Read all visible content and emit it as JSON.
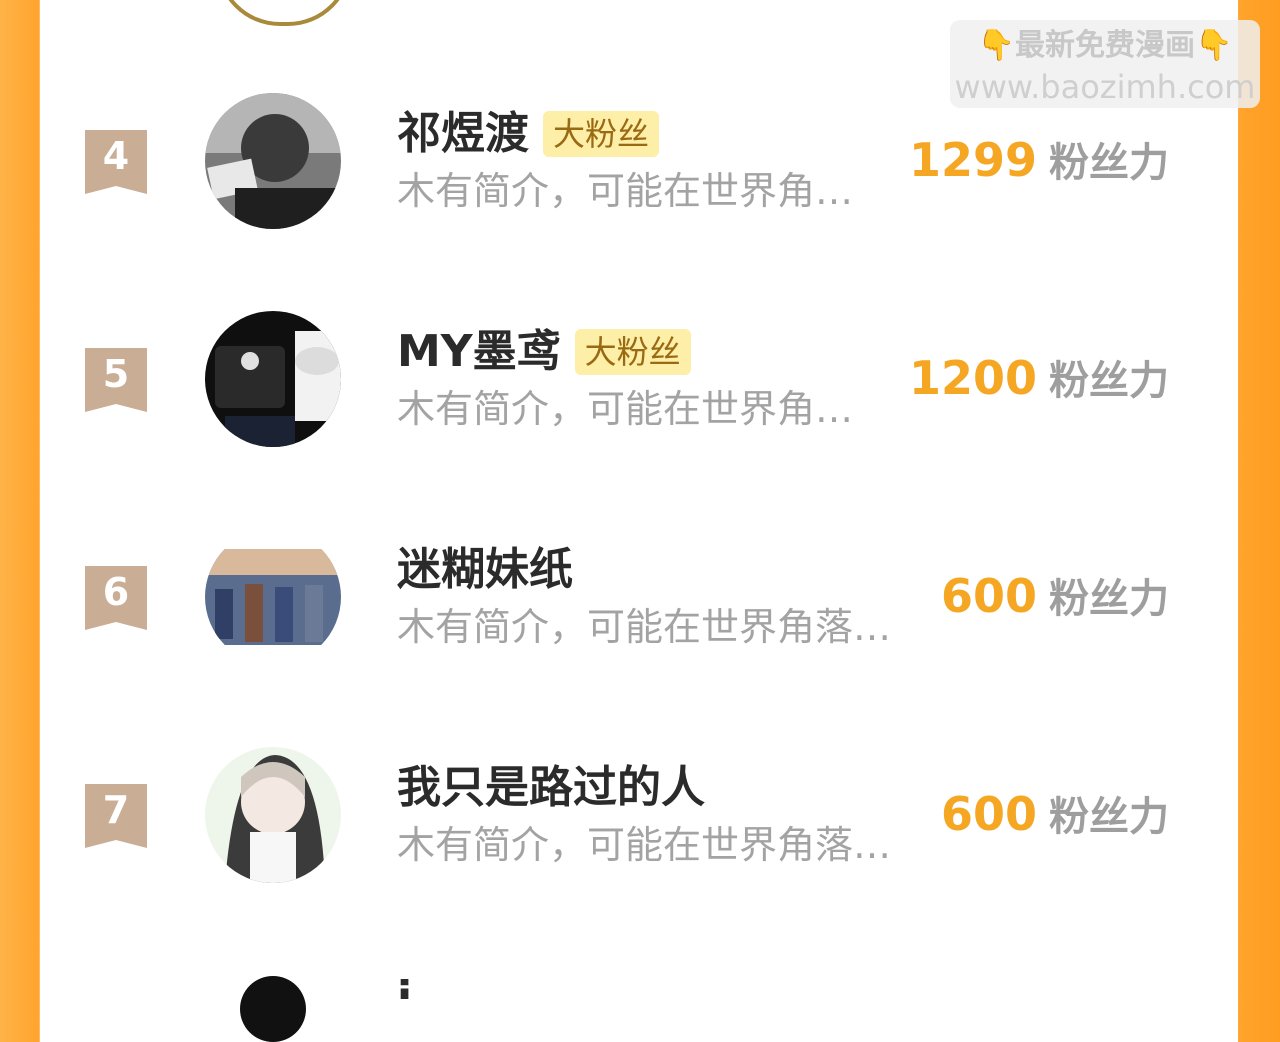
{
  "watermark": {
    "hand_left": "👇",
    "text": "最新免费漫画",
    "hand_right": "👇",
    "url": "www.baozimh.com"
  },
  "ranking": [
    {
      "rank": "4",
      "name": "祁煜渡",
      "badge": "大粉丝",
      "desc": "木有简介，可能在世界角…",
      "score": "1299",
      "unit": "粉丝力"
    },
    {
      "rank": "5",
      "name": "MY墨鸢",
      "badge": "大粉丝",
      "desc": "木有简介，可能在世界角…",
      "score": "1200",
      "unit": "粉丝力"
    },
    {
      "rank": "6",
      "name": "迷糊妹纸",
      "desc": "木有简介，可能在世界角落…",
      "score": "600",
      "unit": "粉丝力"
    },
    {
      "rank": "7",
      "name": "我只是路过的人",
      "desc": "木有简介，可能在世界角落…",
      "score": "600",
      "unit": "粉丝力"
    }
  ],
  "partial_next": {
    "name": "i"
  },
  "colors": {
    "accent": "#f5a623",
    "rank_badge": "#c9ad95",
    "side_orange": "#ffa42e",
    "fan_badge_bg": "#fdeea8"
  }
}
